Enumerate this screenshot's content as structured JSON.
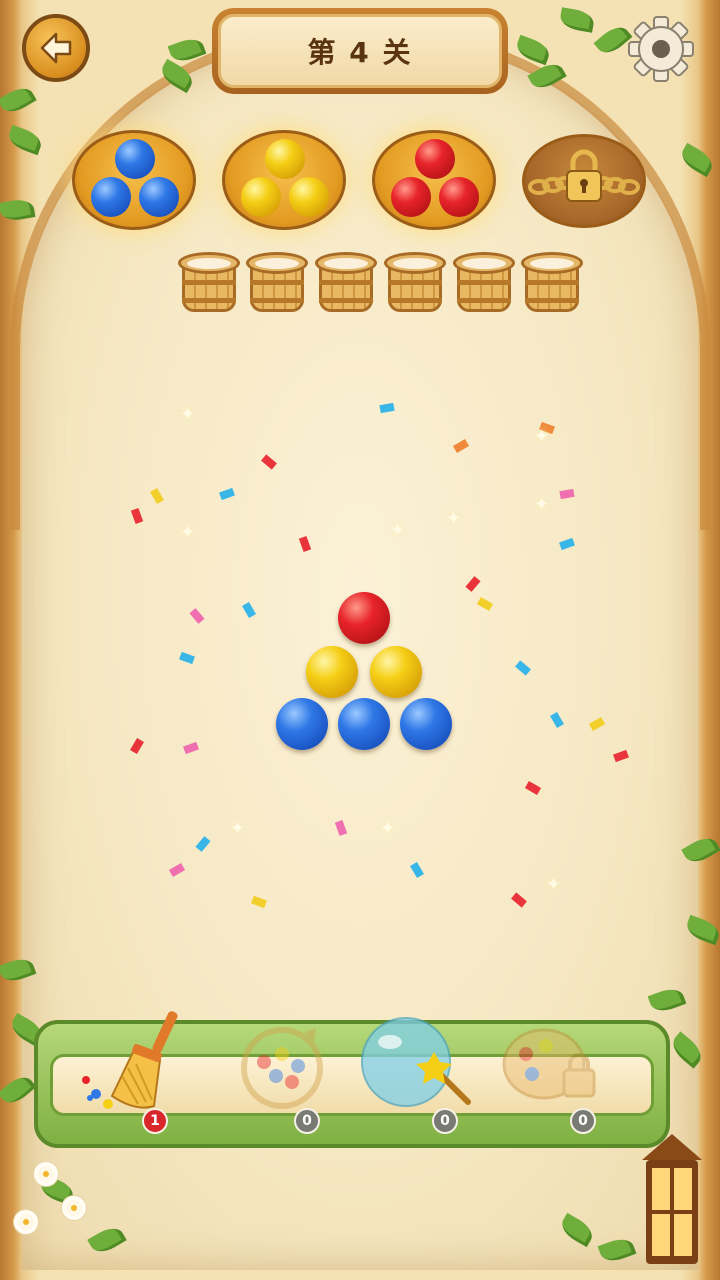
{
  "header": {
    "level_label": "第 4 关",
    "back_icon": "arrow-left-icon",
    "settings_icon": "gear-icon"
  },
  "targets": [
    {
      "color": "blue",
      "locked": false
    },
    {
      "color": "yellow",
      "locked": false
    },
    {
      "color": "red",
      "locked": false
    },
    {
      "color": "none",
      "locked": true,
      "icon": "chain-lock-icon"
    }
  ],
  "buckets": {
    "count": 6,
    "state": "empty"
  },
  "balls": [
    {
      "row": 1,
      "colors": [
        "red"
      ]
    },
    {
      "row": 2,
      "colors": [
        "yellow",
        "yellow"
      ]
    },
    {
      "row": 3,
      "colors": [
        "blue",
        "blue",
        "blue"
      ]
    }
  ],
  "tools": [
    {
      "name": "broom",
      "icon": "broom-icon",
      "count": "1",
      "enabled": true
    },
    {
      "name": "shuffle",
      "icon": "shuffle-icon",
      "count": "0",
      "enabled": false
    },
    {
      "name": "magic-bubble",
      "icon": "magic-bubble-icon",
      "count": "0",
      "enabled": false
    },
    {
      "name": "unlock",
      "icon": "palette-lock-icon",
      "count": "0",
      "enabled": false
    }
  ],
  "colors": {
    "blue": "#2f78e6",
    "yellow": "#f5cf16",
    "red": "#e8242a",
    "accent_gold": "#e39a21",
    "tray_green": "#7fb042"
  }
}
